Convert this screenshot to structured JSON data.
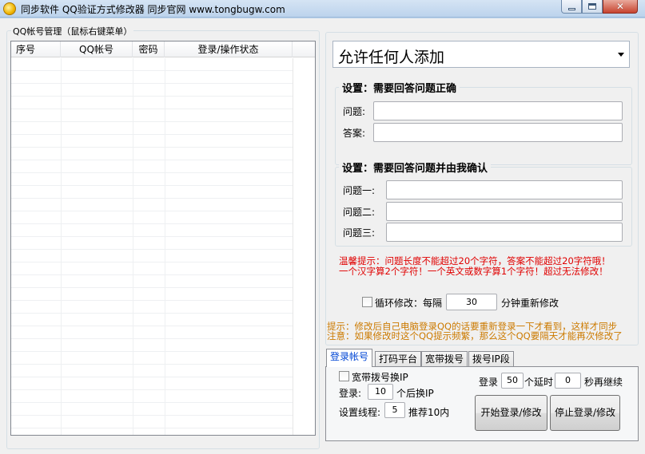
{
  "window": {
    "title": "同步软件  QQ验证方式修改器 同步官网  www.tongbugw.com",
    "min_icon": "minimize-icon",
    "max_icon": "maximize-icon",
    "close_icon": "close-icon"
  },
  "accounts": {
    "group_label": "QQ帐号管理（鼠标右键菜单）",
    "columns": [
      "序号",
      "QQ帐号",
      "密码",
      "登录/操作状态",
      ""
    ]
  },
  "verify": {
    "mode_selected": "允许任何人添加",
    "section1_title": "设置：需要回答问题正确",
    "question_label": "问题:",
    "answer_label": "答案:",
    "question_value": "",
    "answer_value": "",
    "section2_title": "设置：需要回答问题并由我确认",
    "q1_label": "问题一:",
    "q2_label": "问题二:",
    "q3_label": "问题三:",
    "q1_value": "",
    "q2_value": "",
    "q3_value": "",
    "warm_tip_line1": "温馨提示：问题长度不能超过20个字符，答案不能超过20字符哦！",
    "warm_tip_line2": "一个汉字算2个字符！一个英文或数字算1个字符！超过无法修改！",
    "loop_label": "循环修改：每隔",
    "loop_minutes": "30",
    "loop_suffix": "分钟重新修改"
  },
  "notice": {
    "line1": "提示：修改后自己电脑登录QQ的话要重新登录一下才看到，这样才同步",
    "line2": "注意：如果修改时这个QQ提示频繁，那么这个QQ要隔天才能再次修改了"
  },
  "tabs": [
    "登录帐号",
    "打码平台",
    "宽带拨号",
    "拨号IP段"
  ],
  "login": {
    "broadband_label": "宽带拨号换IP",
    "login_prefix": "登录:",
    "login_count": "10",
    "login_suffix": "个后换IP",
    "threads_label": "设置线程:",
    "threads_value": "5",
    "threads_hint": "推荐10内",
    "delay_prefix": "登录",
    "delay_count": "50",
    "delay_mid": "个延时",
    "delay_seconds": "0",
    "delay_suffix": "秒再继续",
    "start_button": "开始登录/修改",
    "stop_button": "停止登录/修改"
  }
}
